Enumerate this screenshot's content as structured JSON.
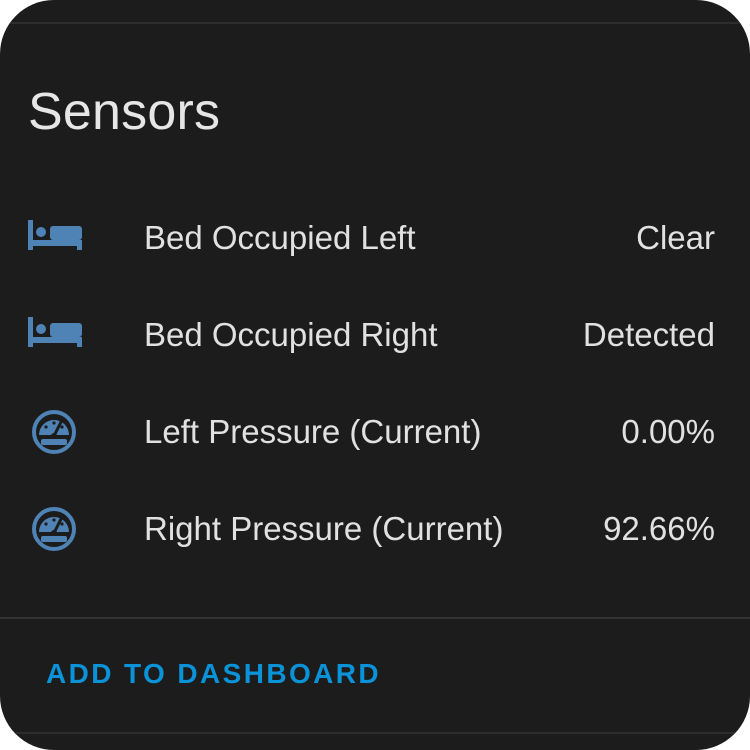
{
  "card": {
    "title": "Sensors",
    "rows": [
      {
        "icon": "bed-icon",
        "label": "Bed Occupied Left",
        "value": "Clear"
      },
      {
        "icon": "bed-icon",
        "label": "Bed Occupied Right",
        "value": "Detected"
      },
      {
        "icon": "gauge-icon",
        "label": "Left Pressure (Current)",
        "value": "0.00%"
      },
      {
        "icon": "gauge-icon",
        "label": "Right Pressure (Current)",
        "value": "92.66%"
      }
    ],
    "action_label": "ADD TO DASHBOARD"
  },
  "colors": {
    "background": "#1c1c1c",
    "icon": "#4f82b5",
    "text": "#e1e1e1",
    "accent": "#0a93d8"
  }
}
